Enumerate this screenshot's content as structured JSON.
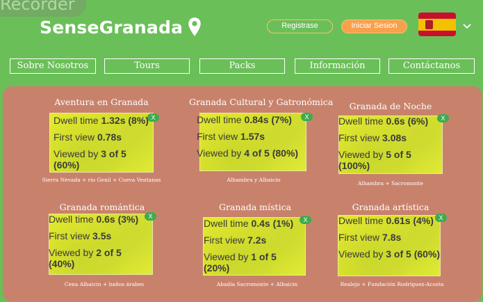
{
  "recorder": {
    "label": "Recorder"
  },
  "brand": {
    "name": "SenseGranada"
  },
  "header": {
    "register_label": "Registrase",
    "login_label": "Iniciar Sesion",
    "language_flag": "es-flag-icon"
  },
  "nav": [
    {
      "label": "Sobre Nosotros"
    },
    {
      "label": "Tours"
    },
    {
      "label": "Packs"
    },
    {
      "label": "Información"
    },
    {
      "label": "Contáctanos"
    }
  ],
  "cards": [
    {
      "title": "Aventura en Granada",
      "subtitle": "Sierra Nevada + rio Genil + Cueva Ventanas",
      "heatmap": {
        "dwell_label": "Dwell time",
        "dwell": "1.32s (8%)",
        "first_label": "First view",
        "first": "0.78s",
        "viewed_label": "Viewed by",
        "viewed": "3 of 5",
        "viewed_pct": "(60%)",
        "close": "X"
      }
    },
    {
      "title": "Granada Cultural y Gatronómica",
      "subtitle": "Alhambra y Albaicin",
      "heatmap": {
        "dwell_label": "Dwell time",
        "dwell": "0.84s (7%)",
        "first_label": "First view",
        "first": "1.57s",
        "viewed_label": "Viewed by",
        "viewed": "4 of 5",
        "viewed_pct": "(80%)",
        "close": "X"
      }
    },
    {
      "title": "Granada de Noche",
      "subtitle": "Alhambra + Sacromonte",
      "heatmap": {
        "dwell_label": "Dwell time",
        "dwell": "0.6s (6%)",
        "first_label": "First view",
        "first": "3.08s",
        "viewed_label": "Viewed by",
        "viewed": "5 of 5",
        "viewed_pct": "(100%)",
        "close": "X"
      }
    },
    {
      "title": "Granada romántica",
      "subtitle": "Cena Albaicin + baños árabes",
      "heatmap": {
        "dwell_label": "Dwell time",
        "dwell": "0.6s (3%)",
        "first_label": "First view",
        "first": "3.5s",
        "viewed_label": "Viewed by",
        "viewed": "2 of 5",
        "viewed_pct": "(40%)",
        "close": "X"
      }
    },
    {
      "title": "Granada mística",
      "subtitle": "Abadía Sacromonte + Albaicin",
      "heatmap": {
        "dwell_label": "Dwell time",
        "dwell": "0.4s (1%)",
        "first_label": "First view",
        "first": "7.2s",
        "viewed_label": "Viewed by",
        "viewed": "1 of 5",
        "viewed_pct": "(20%)",
        "close": "X"
      }
    },
    {
      "title": "Granada artística",
      "subtitle": "Realejo + Fundación Rodríguez-Acosta",
      "heatmap": {
        "dwell_label": "Dwell time",
        "dwell": "0.61s (4%)",
        "first_label": "First view",
        "first": "7.8s",
        "viewed_label": "Viewed by",
        "viewed": "3 of 5",
        "viewed_pct": "(60%)",
        "close": "X"
      }
    }
  ]
}
